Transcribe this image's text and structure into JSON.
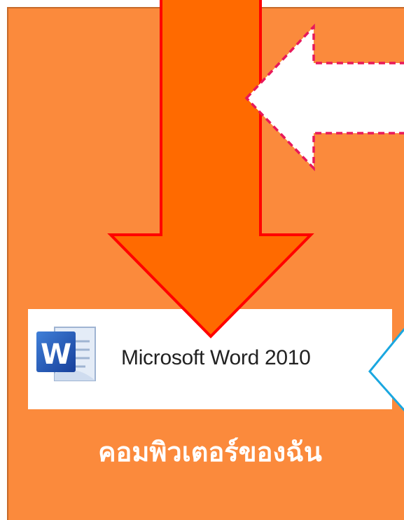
{
  "app_tile": {
    "label": "Microsoft Word 2010",
    "icon": "microsoft-word-icon",
    "icon_letter": "W"
  },
  "caption": "คอมพิวเตอร์ของฉัน",
  "colors": {
    "panel": "#fb8a3c",
    "big_arrow_fill": "#ff6a00",
    "big_arrow_outline": "#ff0000",
    "dashed_arrow_outline": "#e8185a",
    "callout_outline": "#1aa7e0"
  }
}
